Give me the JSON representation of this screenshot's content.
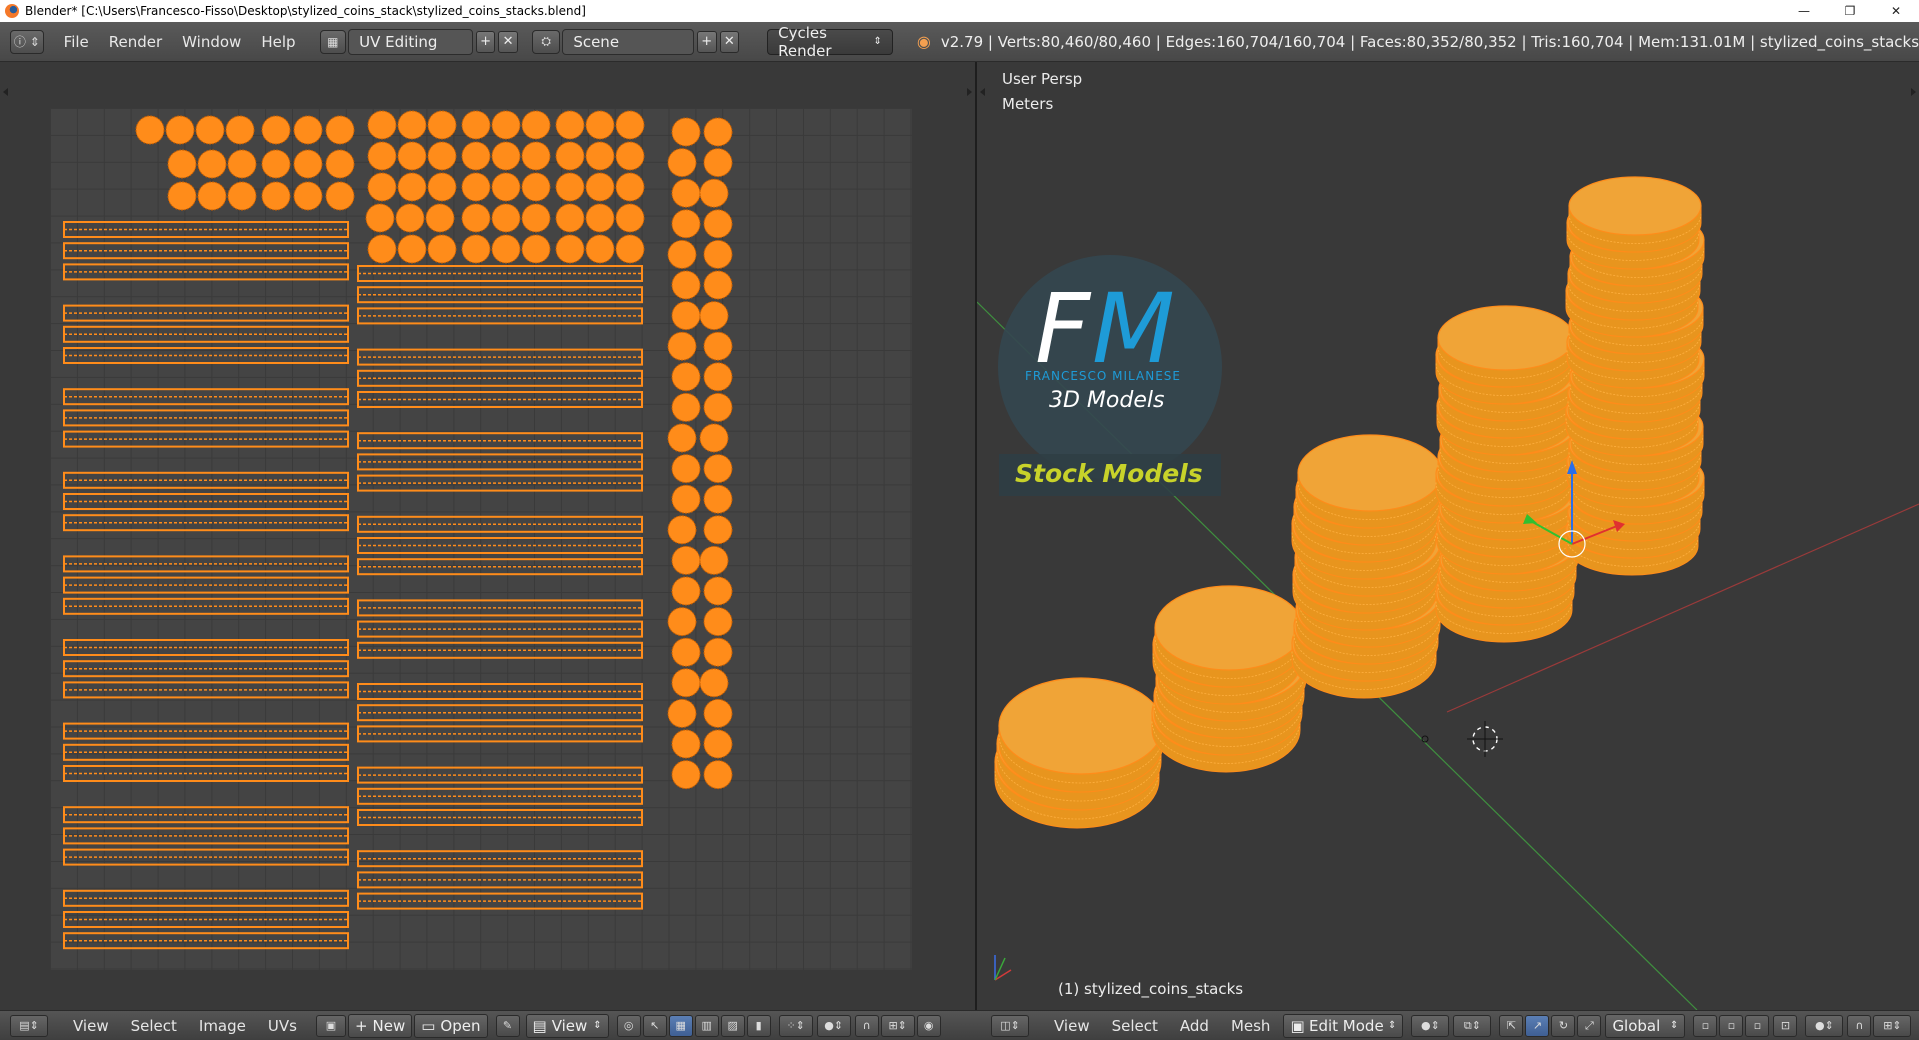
{
  "window": {
    "title": "Blender* [C:\\Users\\Francesco-Fisso\\Desktop\\stylized_coins_stack\\stylized_coins_stacks.blend]",
    "minimize": "—",
    "restore": "❐",
    "close": "✕"
  },
  "infobar": {
    "menus": [
      "File",
      "Render",
      "Window",
      "Help"
    ],
    "screen_layout": "UV Editing",
    "scene": "Scene",
    "render_engine": "Cycles Render",
    "stats": "v2.79 | Verts:80,460/80,460 | Edges:160,704/160,704 | Faces:80,352/80,352 | Tris:160,704 | Mem:131.01M | stylized_coins_stacks"
  },
  "viewport": {
    "view_name": "User Persp",
    "units": "Meters",
    "object_label": "(1) stylized_coins_stacks",
    "overlay_logo": {
      "letters_f": "F",
      "letters_m": "M",
      "name": "FRANCESCO MILANESE",
      "sub": "3D Models",
      "banner": "Stock Models"
    }
  },
  "uv_bottombar": {
    "menus": [
      "View",
      "Select",
      "Image",
      "UVs"
    ],
    "new_label": "New",
    "open_label": "Open",
    "view_label": "View"
  },
  "vp_bottombar": {
    "menus": [
      "View",
      "Select",
      "Add",
      "Mesh"
    ],
    "mode": "Edit Mode",
    "orientation": "Global"
  },
  "colors": {
    "uv_orange": "#ff8c1a",
    "accent_blue": "#1e9bd7",
    "stock_yellow": "#c8d22a"
  }
}
